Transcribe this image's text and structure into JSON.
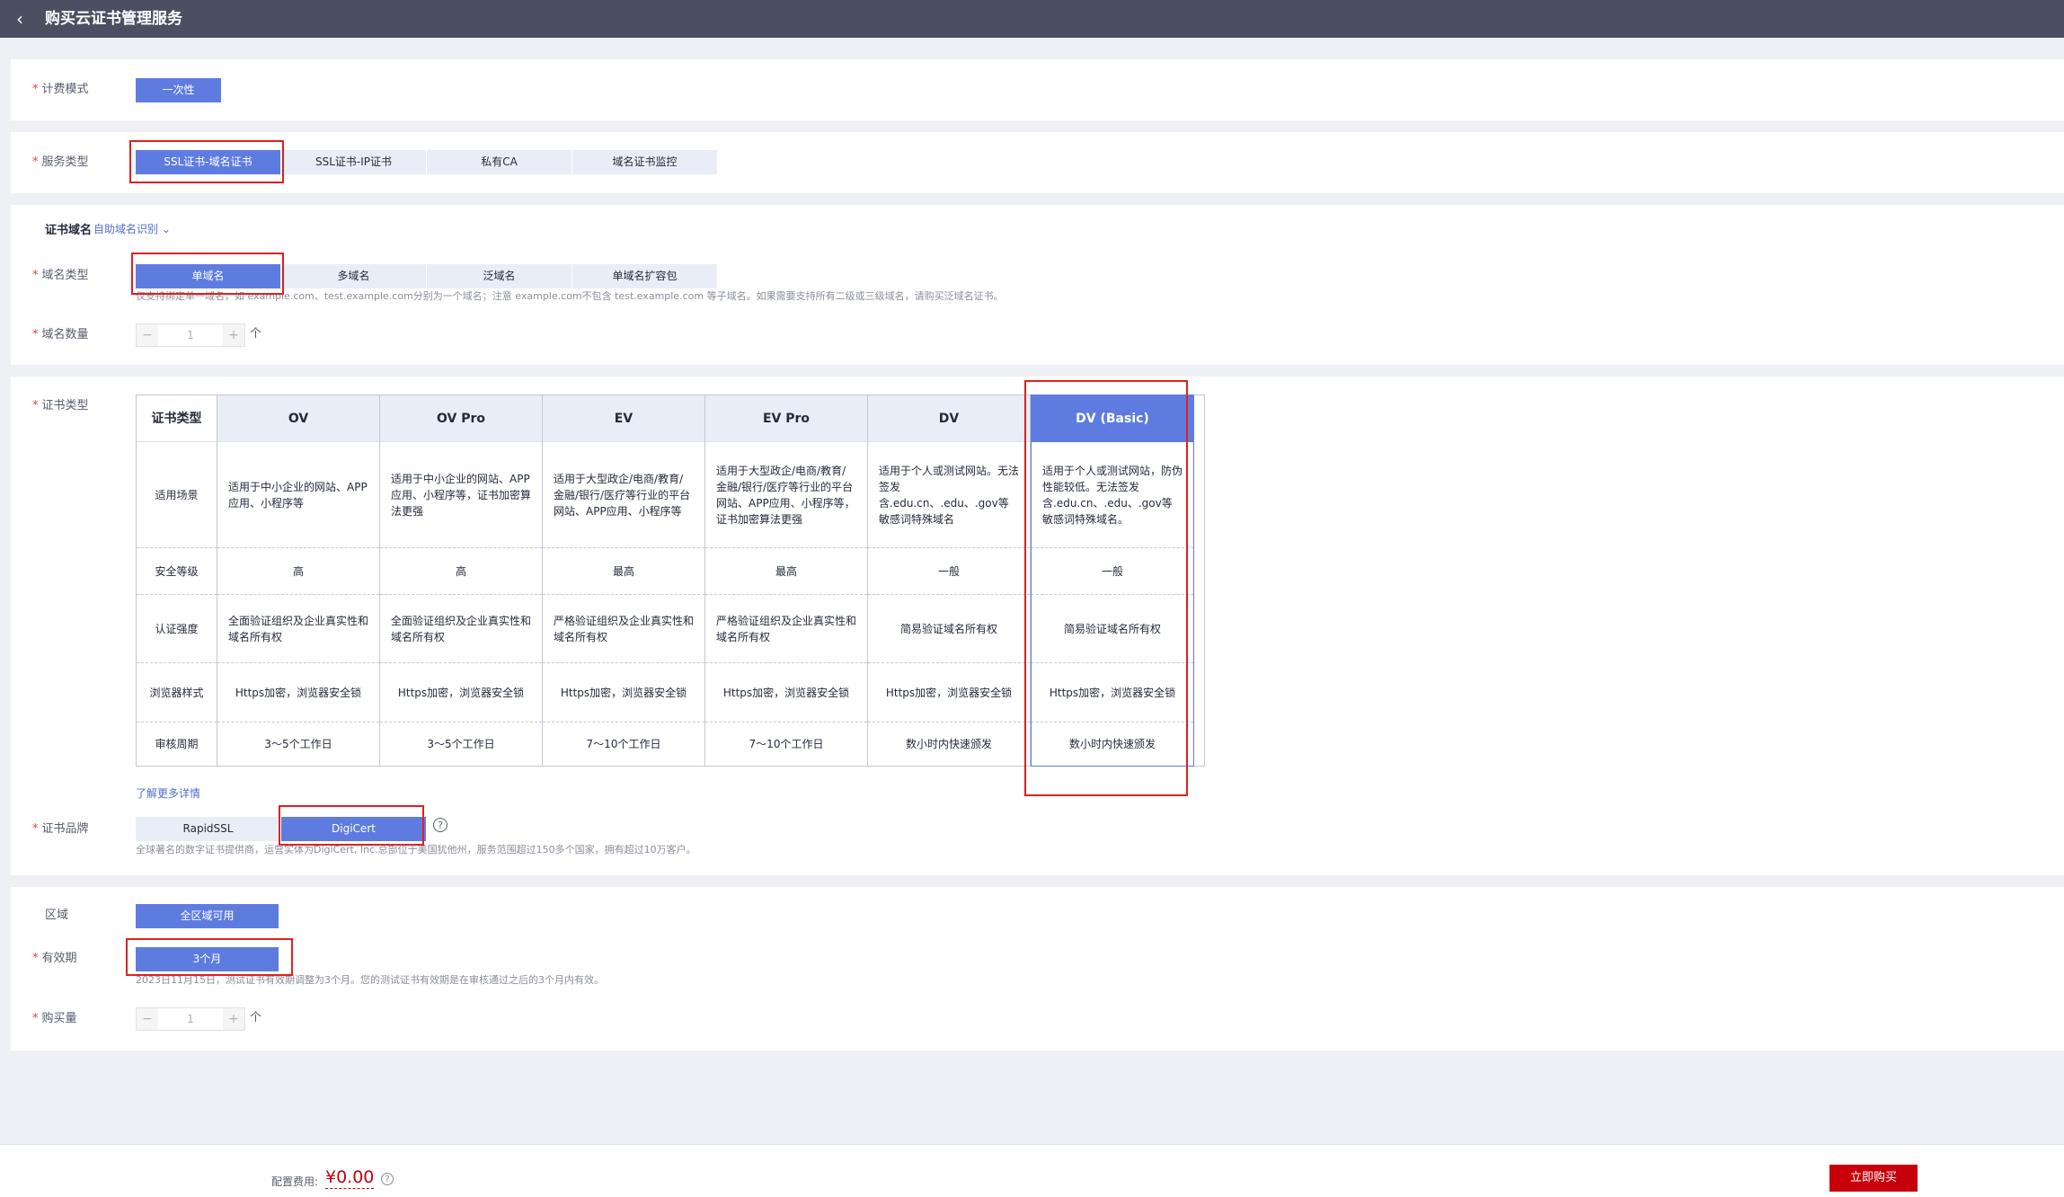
{
  "header": {
    "back_icon": "chevron-left-icon",
    "title": "购买云证书管理服务"
  },
  "billing": {
    "label": "计费模式",
    "option": "一次性"
  },
  "service_type": {
    "label": "服务类型",
    "options": [
      "SSL证书-域名证书",
      "SSL证书-IP证书",
      "私有CA",
      "域名证书监控"
    ],
    "selected": 0
  },
  "cert_domain": {
    "section_title": "证书域名",
    "auto_detect": "自助域名识别",
    "domain_type": {
      "label": "域名类型",
      "options": [
        "单域名",
        "多域名",
        "泛域名",
        "单域名扩容包"
      ],
      "selected": 0
    },
    "hint": "仅支持绑定单一域名，如 example.com、test.example.com分别为一个域名；注意 example.com不包含 test.example.com 等子域名。如果需要支持所有二级或三级域名，请购买泛域名证书。",
    "count_label": "域名数量",
    "count_value": "1",
    "unit": "个"
  },
  "cert_type": {
    "label": "证书类型",
    "row_header": "证书类型",
    "row_labels": [
      "适用场景",
      "安全等级",
      "认证强度",
      "浏览器样式",
      "审核周期"
    ],
    "columns": [
      {
        "name": "OV",
        "scene": "适用于中小企业的网站、APP应用、小程序等",
        "level": "高",
        "auth": "全面验证组织及企业真实性和域名所有权",
        "browser": "Https加密，浏览器安全锁",
        "period": "3～5个工作日"
      },
      {
        "name": "OV Pro",
        "scene": "适用于中小企业的网站、APP应用、小程序等，证书加密算法更强",
        "level": "高",
        "auth": "全面验证组织及企业真实性和域名所有权",
        "browser": "Https加密，浏览器安全锁",
        "period": "3～5个工作日"
      },
      {
        "name": "EV",
        "scene": "适用于大型政企/电商/教育/金融/银行/医疗等行业的平台网站、APP应用、小程序等",
        "level": "最高",
        "auth": "严格验证组织及企业真实性和域名所有权",
        "browser": "Https加密，浏览器安全锁",
        "period": "7～10个工作日"
      },
      {
        "name": "EV Pro",
        "scene": "适用于大型政企/电商/教育/金融/银行/医疗等行业的平台网站、APP应用、小程序等，证书加密算法更强",
        "level": "最高",
        "auth": "严格验证组织及企业真实性和域名所有权",
        "browser": "Https加密，浏览器安全锁",
        "period": "7～10个工作日"
      },
      {
        "name": "DV",
        "scene": "适用于个人或测试网站。无法签发含.edu.cn、.edu、.gov等敏感词特殊域名",
        "level": "一般",
        "auth": "简易验证域名所有权",
        "browser": "Https加密，浏览器安全锁",
        "period": "数小时内快速颁发"
      },
      {
        "name": "DV (Basic)",
        "scene": "适用于个人或测试网站，防伪性能较低。无法签发含.edu.cn、.edu、.gov等敏感词特殊域名。",
        "level": "一般",
        "auth": "简易验证域名所有权",
        "browser": "Https加密，浏览器安全锁",
        "period": "数小时内快速颁发"
      }
    ],
    "selected": 5,
    "learn_more": "了解更多详情"
  },
  "brand": {
    "label": "证书品牌",
    "options": [
      "RapidSSL",
      "DigiCert"
    ],
    "selected": 1,
    "help_icon": "question-circle-icon",
    "hint": "全球著名的数字证书提供商，运营实体为DigiCert, Inc.总部位于美国犹他州，服务范围超过150多个国家，拥有超过10万客户。"
  },
  "region": {
    "label": "区域",
    "option": "全区域可用"
  },
  "validity": {
    "label": "有效期",
    "option": "3个月",
    "hint": "2023日11月15日，测试证书有效期调整为3个月。您的测试证书有效期是在审核通过之后的3个月内有效。"
  },
  "quantity": {
    "label": "购买量",
    "value": "1",
    "unit": "个"
  },
  "footer": {
    "fee_label": "配置费用:",
    "fee_value": "¥0.00",
    "help_icon": "question-circle-icon",
    "buy_button": "立即购买"
  },
  "colors": {
    "primary": "#5e7ce0",
    "topbar": "#4a5062",
    "buy": "#c7000b",
    "highlight": "#e02020",
    "price": "#c7000b"
  }
}
